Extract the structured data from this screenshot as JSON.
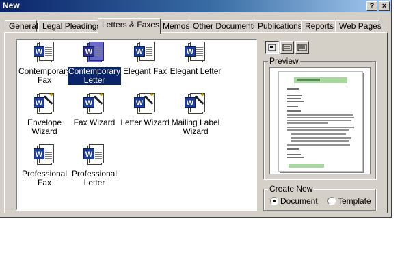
{
  "window": {
    "title": "New",
    "help_label": "?",
    "close_label": "×"
  },
  "tabs": [
    {
      "label": "General"
    },
    {
      "label": "Legal Pleadings"
    },
    {
      "label": "Letters & Faxes"
    },
    {
      "label": "Memos"
    },
    {
      "label": "Other Documents"
    },
    {
      "label": "Publications"
    },
    {
      "label": "Reports"
    },
    {
      "label": "Web Pages"
    }
  ],
  "active_tab": "Letters & Faxes",
  "templates": [
    {
      "line1": "Contemporary",
      "line2": "Fax",
      "kind": "template",
      "selected": false
    },
    {
      "line1": "Contemporary",
      "line2": "Letter",
      "kind": "template",
      "selected": true
    },
    {
      "line1": "Elegant Fax",
      "line2": "",
      "kind": "template",
      "selected": false
    },
    {
      "line1": "Elegant Letter",
      "line2": "",
      "kind": "template",
      "selected": false
    },
    {
      "line1": "Envelope",
      "line2": "Wizard",
      "kind": "wizard",
      "selected": false
    },
    {
      "line1": "Fax Wizard",
      "line2": "",
      "kind": "wizard",
      "selected": false
    },
    {
      "line1": "Letter Wizard",
      "line2": "",
      "kind": "wizard",
      "selected": false
    },
    {
      "line1": "Mailing Label",
      "line2": "Wizard",
      "kind": "wizard",
      "selected": false
    },
    {
      "line1": "Professional",
      "line2": "Fax",
      "kind": "template",
      "selected": false
    },
    {
      "line1": "Professional",
      "line2": "Letter",
      "kind": "template",
      "selected": false
    }
  ],
  "icon_badge": "W",
  "view_buttons": [
    {
      "name": "large-icons-view",
      "active": true
    },
    {
      "name": "list-view",
      "active": false
    },
    {
      "name": "details-view",
      "active": false
    }
  ],
  "preview": {
    "label": "Preview"
  },
  "create_new": {
    "label": "Create New",
    "document_label": "Document",
    "template_label": "Template",
    "selected": "Document"
  },
  "colors": {
    "titlebar_start": "#0a246a",
    "selection": "#0a246a",
    "face": "#d4d0c8",
    "preview_accent": "#a8d8a0"
  }
}
